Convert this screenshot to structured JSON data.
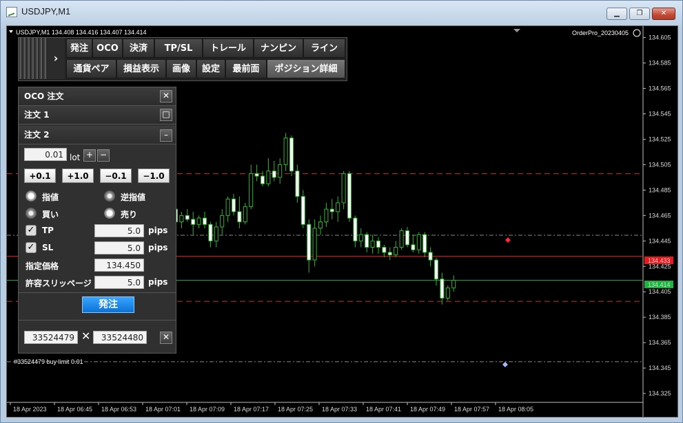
{
  "window": {
    "title": "USDJPY,M1"
  },
  "chart": {
    "header_text": "USDJPY,M1  134.408 134.416 134.407 134.414",
    "ea_label": "OrderPro_20230405",
    "bid_label": "134.433",
    "ask_label": "134.414",
    "order_line_label": "#33524479 buy limit 0.01"
  },
  "toolbar": {
    "row1": [
      "発注",
      "OCO",
      "決済",
      "TP/SL",
      "トレール",
      "ナンピン",
      "ライン"
    ],
    "row2": [
      "通貨ペア",
      "損益表示",
      "画像",
      "設定",
      "最前面",
      "ポジション詳細"
    ]
  },
  "panel": {
    "title": "OCO 注文",
    "order1": "注文 1",
    "order2": "注文 2",
    "lot_value": "0.01",
    "lot_unit": "lot",
    "steps": [
      "+0.1",
      "+1.0",
      "−0.1",
      "−1.0"
    ],
    "limit": "指値",
    "stop": "逆指値",
    "buy": "買い",
    "sell": "売り",
    "tp_label": "TP",
    "tp_value": "5.0",
    "sl_label": "SL",
    "sl_value": "5.0",
    "pips": "pips",
    "price_label": "指定価格",
    "price_value": "134.450",
    "slip_label": "許容スリッページ",
    "slip_value": "5.0",
    "submit": "発注",
    "ticket1": "33524479",
    "ticket2": "33524480"
  },
  "chart_data": {
    "type": "candlestick",
    "y_ticks": [
      "134.605",
      "134.585",
      "134.565",
      "134.545",
      "134.525",
      "134.505",
      "134.485",
      "134.465",
      "134.445",
      "134.425",
      "134.405",
      "134.385",
      "134.365",
      "134.345",
      "134.325"
    ],
    "x_ticks": [
      "18 Apr 2023",
      "18 Apr 06:45",
      "18 Apr 06:53",
      "18 Apr 07:01",
      "18 Apr 07:09",
      "18 Apr 07:17",
      "18 Apr 07:25",
      "18 Apr 07:33",
      "18 Apr 07:41",
      "18 Apr 07:49",
      "18 Apr 07:57",
      "18 Apr 08:05"
    ],
    "ylim": [
      134.318,
      134.614
    ],
    "levels": [
      {
        "price": 134.498,
        "style": "red-dash"
      },
      {
        "price": 134.4495,
        "style": "gray-dashdot"
      },
      {
        "price": 134.433,
        "style": "red-solid"
      },
      {
        "price": 134.414,
        "style": "green-solid"
      },
      {
        "price": 134.3975,
        "style": "red-dash"
      },
      {
        "price": 134.35,
        "style": "gray-dashdot"
      }
    ],
    "candles": [
      [
        134.47,
        134.475,
        134.455,
        134.46
      ],
      [
        134.46,
        134.468,
        134.455,
        134.465
      ],
      [
        134.465,
        134.47,
        134.46,
        134.462
      ],
      [
        134.462,
        134.468,
        134.45,
        134.458
      ],
      [
        134.458,
        134.465,
        134.455,
        134.463
      ],
      [
        134.463,
        134.468,
        134.455,
        134.458
      ],
      [
        134.458,
        134.46,
        134.44,
        134.445
      ],
      [
        134.445,
        134.46,
        134.44,
        134.456
      ],
      [
        134.456,
        134.47,
        134.45,
        134.465
      ],
      [
        134.465,
        134.48,
        134.46,
        134.478
      ],
      [
        134.478,
        134.482,
        134.465,
        134.468
      ],
      [
        134.468,
        134.48,
        134.455,
        134.46
      ],
      [
        134.46,
        134.475,
        134.458,
        134.472
      ],
      [
        134.472,
        134.505,
        134.47,
        134.498
      ],
      [
        134.498,
        134.505,
        134.492,
        134.496
      ],
      [
        134.496,
        134.5,
        134.488,
        134.49
      ],
      [
        134.49,
        134.51,
        134.488,
        134.5
      ],
      [
        134.5,
        134.508,
        134.492,
        134.495
      ],
      [
        134.495,
        134.51,
        134.49,
        134.505
      ],
      [
        134.505,
        134.53,
        134.5,
        134.526
      ],
      [
        134.526,
        134.528,
        134.496,
        134.5
      ],
      [
        134.5,
        134.505,
        134.475,
        134.48
      ],
      [
        134.48,
        134.485,
        134.455,
        134.458
      ],
      [
        134.458,
        134.462,
        134.42,
        134.43
      ],
      [
        134.43,
        134.462,
        134.425,
        134.455
      ],
      [
        134.455,
        134.465,
        134.45,
        134.46
      ],
      [
        134.46,
        134.475,
        134.456,
        134.47
      ],
      [
        134.47,
        134.478,
        134.462,
        134.468
      ],
      [
        134.468,
        134.48,
        134.46,
        134.475
      ],
      [
        134.475,
        134.5,
        134.47,
        134.498
      ],
      [
        134.498,
        134.5,
        134.46,
        134.463
      ],
      [
        134.463,
        134.465,
        134.44,
        134.445
      ],
      [
        134.445,
        134.455,
        134.44,
        134.45
      ],
      [
        134.45,
        134.452,
        134.436,
        134.44
      ],
      [
        134.44,
        134.45,
        134.435,
        134.445
      ],
      [
        134.445,
        134.448,
        134.435,
        134.44
      ],
      [
        134.44,
        134.442,
        134.432,
        134.436
      ],
      [
        134.436,
        134.44,
        134.43,
        134.434
      ],
      [
        134.434,
        134.445,
        134.432,
        134.44
      ],
      [
        134.44,
        134.455,
        134.438,
        134.453
      ],
      [
        134.453,
        134.456,
        134.44,
        134.442
      ],
      [
        134.442,
        134.45,
        134.436,
        134.438
      ],
      [
        134.438,
        134.452,
        134.435,
        134.45
      ],
      [
        134.45,
        134.452,
        134.432,
        134.436
      ],
      [
        134.436,
        134.44,
        134.425,
        134.43
      ],
      [
        134.43,
        134.432,
        134.41,
        134.415
      ],
      [
        134.415,
        134.42,
        134.395,
        134.4
      ],
      [
        134.4,
        134.41,
        134.398,
        134.408
      ],
      [
        134.408,
        134.418,
        134.405,
        134.414
      ]
    ]
  }
}
